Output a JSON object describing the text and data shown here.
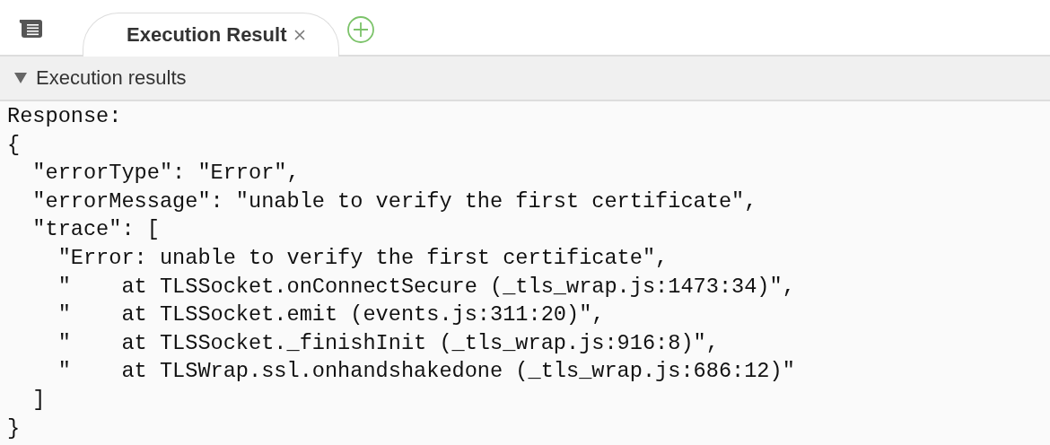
{
  "tabs": [
    {
      "label": "Execution Result",
      "selected": true
    }
  ],
  "section": {
    "title": "Execution results",
    "expanded": true
  },
  "output_lines": [
    "Response:",
    "{",
    "  \"errorType\": \"Error\",",
    "  \"errorMessage\": \"unable to verify the first certificate\",",
    "  \"trace\": [",
    "    \"Error: unable to verify the first certificate\",",
    "    \"    at TLSSocket.onConnectSecure (_tls_wrap.js:1473:34)\",",
    "    \"    at TLSSocket.emit (events.js:311:20)\",",
    "    \"    at TLSSocket._finishInit (_tls_wrap.js:916:8)\",",
    "    \"    at TLSWrap.ssl.onhandshakedone (_tls_wrap.js:686:12)\"",
    "  ]",
    "}"
  ]
}
